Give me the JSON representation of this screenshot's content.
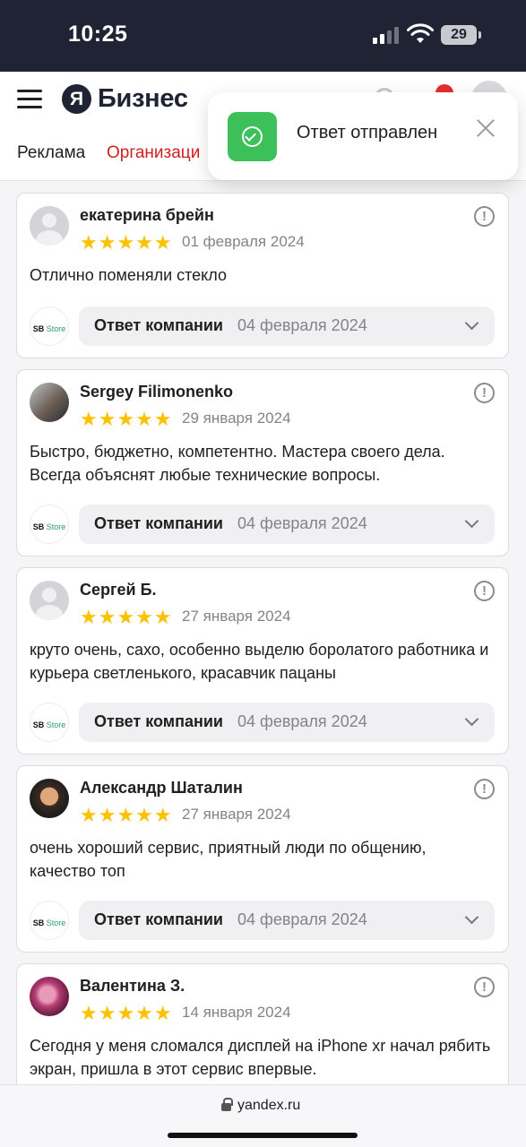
{
  "status_bar": {
    "time": "10:25",
    "battery": "29"
  },
  "header": {
    "logo_mark": "Я",
    "logo_text": "Бизнес"
  },
  "nav": {
    "tabs": [
      {
        "label": "Реклама"
      },
      {
        "label": "Организаци"
      }
    ]
  },
  "toast": {
    "message": "Ответ отправлен"
  },
  "reviews": [
    {
      "author": "екатерина брейн",
      "rating": 5,
      "stars": "★★★★★",
      "date": "01 февраля 2024",
      "text": "Отлично поменяли стекло",
      "reply_label": "Ответ компании",
      "reply_date": "04 февраля 2024"
    },
    {
      "author": "Sergey Filimonenko",
      "rating": 5,
      "stars": "★★★★★",
      "date": "29 января 2024",
      "text": "Быстро, бюджетно, компетентно. Мастера своего дела. Всегда объяснят любые технические вопросы.",
      "reply_label": "Ответ компании",
      "reply_date": "04 февраля 2024"
    },
    {
      "author": "Сергей Б.",
      "rating": 5,
      "stars": "★★★★★",
      "date": "27 января 2024",
      "text": "круто очень, сахо, особенно выделю боролатого работника и курьера светленького, красавчик пацаны",
      "reply_label": "Ответ компании",
      "reply_date": "04 февраля 2024"
    },
    {
      "author": "Александр Шаталин",
      "rating": 5,
      "stars": "★★★★★",
      "date": "27 января 2024",
      "text": "очень хороший сервис, приятный люди по общению, качество топ",
      "reply_label": "Ответ компании",
      "reply_date": "04 февраля 2024"
    },
    {
      "author": "Валентина З.",
      "rating": 5,
      "stars": "★★★★★",
      "date": "14 января 2024",
      "text": "Сегодня у меня сломался дисплей на iPhone xr начал рябить экран, пришла в этот сервис впервые."
    }
  ],
  "company_logo": {
    "apple": "",
    "name_a": "SB ",
    "name_b": "Store"
  },
  "browser": {
    "url": "yandex.ru"
  },
  "colors": {
    "accent_red": "#d31e20",
    "star": "#fcc200",
    "toast_green": "#3dbf5a",
    "status_bar": "#1f2333"
  }
}
